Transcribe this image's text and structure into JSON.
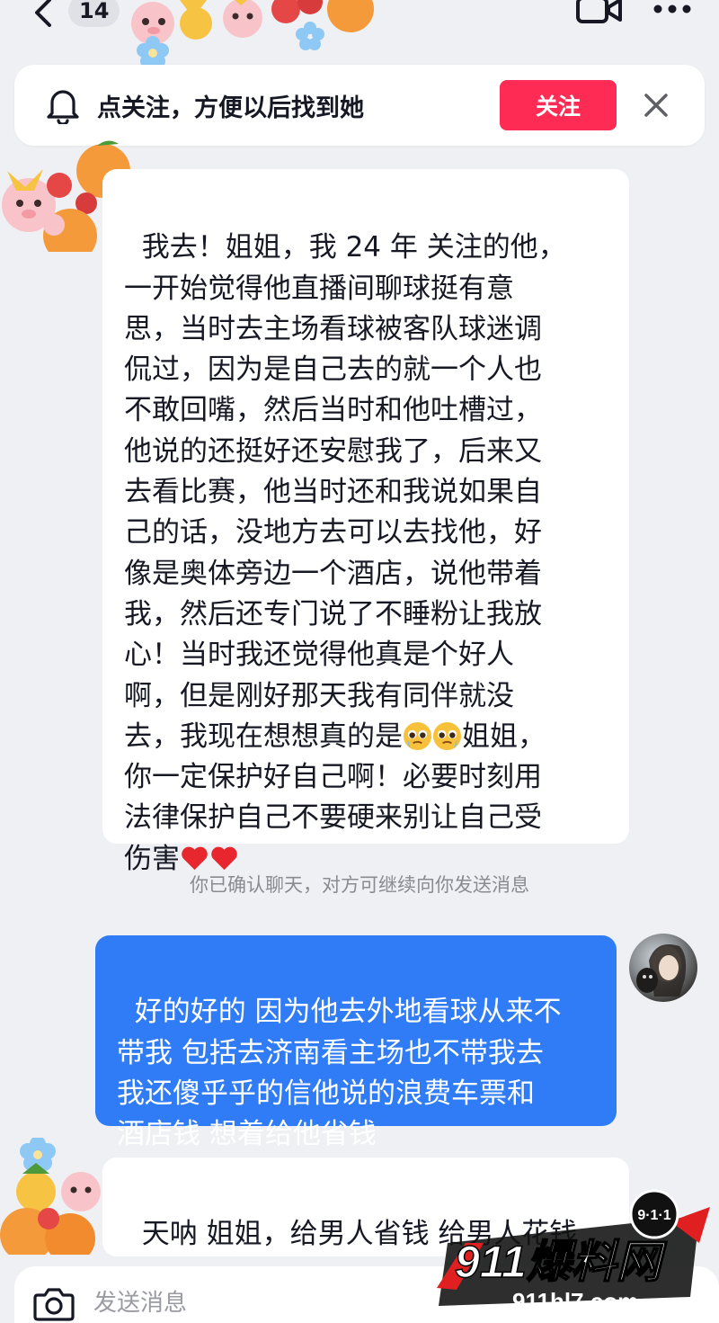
{
  "header": {
    "unread_count": "14"
  },
  "banner": {
    "text": "点关注，方便以后找到她",
    "follow_label": "关注"
  },
  "messages": [
    {
      "side": "left",
      "text": "我去！姐姐，我 24 年 关注的他，\n一开始觉得他直播间聊球挺有意\n思，当时去主场看球被客队球迷调\n侃过，因为是自己去的就一个人也\n不敢回嘴，然后当时和他吐槽过，\n他说的还挺好还安慰我了，后来又\n去看比赛，他当时还和我说如果自\n己的话，没地方去可以去找他，好\n像是奥体旁边一个酒店，说他带着\n我，然后还专门说了不睡粉让我放\n心！当时我还觉得他真是个好人\n啊，但是刚好那天我有同伴就没\n去，我现在想想真的是",
      "emoji_mid": "pleading-face-emoji",
      "text_after_emoji": "姐姐，\n你一定保护好自己啊！必要时刻用\n法律保护自己不要硬来别让自己受\n伤害",
      "emoji_end": "red-heart-emoji"
    },
    {
      "side": "right",
      "text": "好的好的 因为他去外地看球从来不\n带我 包括去济南看主场也不带我去\n我还傻乎乎的信他说的浪费车票和\n酒店钱 想着给他省钱"
    },
    {
      "side": "left",
      "text": "天呐 姐姐，给男人省钱 给男人花钱\n都倒霉一辈子！以后一定要擦亮双"
    }
  ],
  "system_note": "你已确认聊天，对方可继续向你发送消息",
  "input": {
    "placeholder": "发送消息"
  },
  "watermark": {
    "badge": "9·1·1",
    "main": "911爆料网",
    "url": "911hl7.com"
  },
  "colors": {
    "follow_button": "#fe2c55",
    "outgoing_bubble": "#2f7cf6",
    "background": "#eef0f3"
  }
}
